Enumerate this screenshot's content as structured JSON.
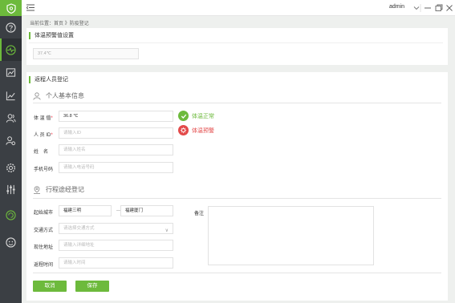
{
  "topbar": {
    "user": "admin"
  },
  "breadcrumb": "当前位置：首页 》防疫登记",
  "panel1": {
    "title": "体温预警值设置",
    "threshold_value": "37.4℃"
  },
  "panel2": {
    "title": "返程人员登记",
    "basic_info": {
      "heading": "个人基本信息",
      "temperature": {
        "label": "体 温 值",
        "required": "*",
        "value": "36.8 ℃"
      },
      "id_number": {
        "label": "人 员 ID",
        "required": "*",
        "placeholder": "请输入ID"
      },
      "name": {
        "label": "姓　名",
        "placeholder": "请输入姓名"
      },
      "phone": {
        "label": "手机号码",
        "placeholder": "请输入电话号码"
      },
      "status_normal": "体温正常",
      "status_warning": "体温预警"
    },
    "itinerary": {
      "heading": "行程途经登记",
      "city": {
        "label": "起始城市",
        "from": "福建三明",
        "separator": "—",
        "to": "福建厦门"
      },
      "transport": {
        "label": "交通方式",
        "placeholder": "请选择交通方式"
      },
      "address": {
        "label": "现住地址",
        "placeholder": "请输入详细地址"
      },
      "return_time": {
        "label": "返程时间",
        "placeholder": "请输入时间"
      },
      "remark": {
        "label": "备注"
      }
    },
    "buttons": {
      "cancel": "取消",
      "save": "保存"
    }
  },
  "colors": {
    "accent": "#6dba3c",
    "warning": "#e34a4a",
    "sidebar": "#3b3f44"
  },
  "icons": [
    "logo-shield-icon",
    "question-icon",
    "dashboard-icon",
    "chart-icon",
    "trend-icon",
    "users-icon",
    "user-group-icon",
    "settings-icon",
    "sliders-icon",
    "refresh-icon",
    "face-icon"
  ]
}
